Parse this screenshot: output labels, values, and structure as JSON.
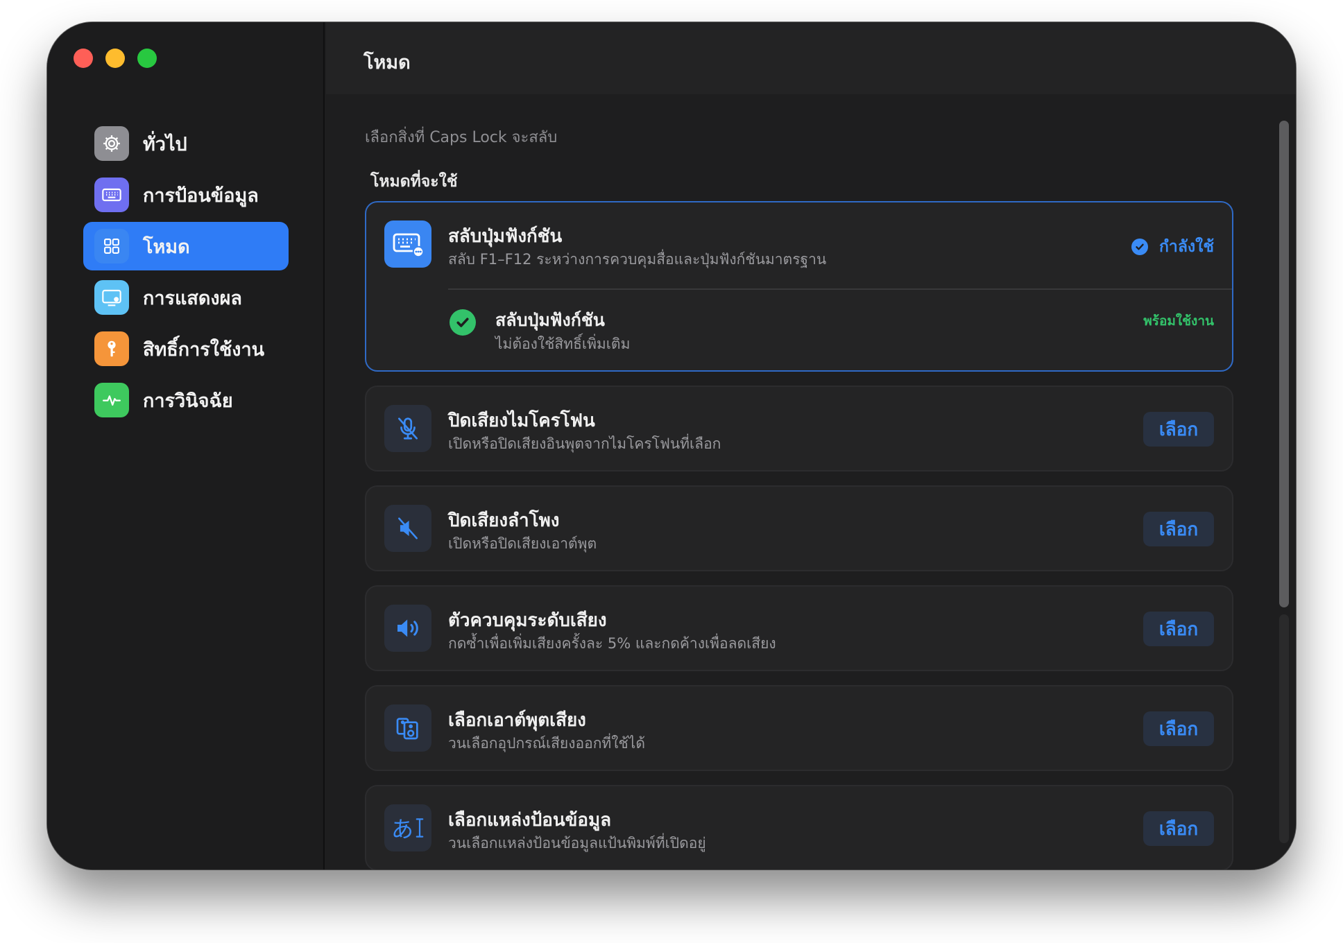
{
  "window": {
    "title": "โหมด"
  },
  "sidebar": {
    "items": [
      {
        "label": "ทั่วไป",
        "icon": "gear-icon",
        "color": "#8e8e93",
        "active": false
      },
      {
        "label": "การป้อนข้อมูล",
        "icon": "keyboard-icon",
        "color": "#6f6ff0",
        "active": false
      },
      {
        "label": "โหมด",
        "icon": "grid-icon",
        "color": "#3a86f2",
        "active": true
      },
      {
        "label": "การแสดงผล",
        "icon": "display-icon",
        "color": "#5ec2f5",
        "active": false
      },
      {
        "label": "สิทธิ์การใช้งาน",
        "icon": "key-icon",
        "color": "#f5953a",
        "active": false
      },
      {
        "label": "การวินิจฉัย",
        "icon": "pulse-icon",
        "color": "#3ec95e",
        "active": false
      }
    ]
  },
  "main": {
    "subtitle": "เลือกสิ่งที่ Caps Lock จะสลับ",
    "section_title": "โหมดที่จะใช้",
    "selected_card": {
      "title": "สลับปุ่มฟังก์ชัน",
      "description": "สลับ F1–F12 ระหว่างการควบคุมสื่อและปุ่มฟังก์ชันมาตรฐาน",
      "status": "กำลังใช้",
      "icon": "function-keyboard-icon",
      "sub": {
        "title": "สลับปุ่มฟังก์ชัน",
        "description": "ไม่ต้องใช้สิทธิ์เพิ่มเติม",
        "status": "พร้อมใช้งาน"
      }
    },
    "cards": [
      {
        "title": "ปิดเสียงไมโครโฟน",
        "description": "เปิดหรือปิดเสียงอินพุตจากไมโครโฟนที่เลือก",
        "button": "เลือก",
        "icon": "mic-slash-icon"
      },
      {
        "title": "ปิดเสียงลำโพง",
        "description": "เปิดหรือปิดเสียงเอาต์พุต",
        "button": "เลือก",
        "icon": "speaker-slash-icon"
      },
      {
        "title": "ตัวควบคุมระดับเสียง",
        "description": "กดซ้ำเพื่อเพิ่มเสียงครั้งละ 5% และกดค้างเพื่อลดเสียง",
        "button": "เลือก",
        "icon": "speaker-wave-icon"
      },
      {
        "title": "เลือกเอาต์พุตเสียง",
        "description": "วนเลือกอุปกรณ์เสียงออกที่ใช้ได้",
        "button": "เลือก",
        "icon": "speakers-icon"
      },
      {
        "title": "เลือกแหล่งป้อนข้อมูล",
        "description": "วนเลือกแหล่งป้อนข้อมูลแป้นพิมพ์ที่เปิดอยู่",
        "button": "เลือก",
        "icon": "input-source-icon",
        "icon_text": "あ"
      }
    ]
  },
  "colors": {
    "accent": "#3a8bf5",
    "ready": "#33c26a"
  }
}
